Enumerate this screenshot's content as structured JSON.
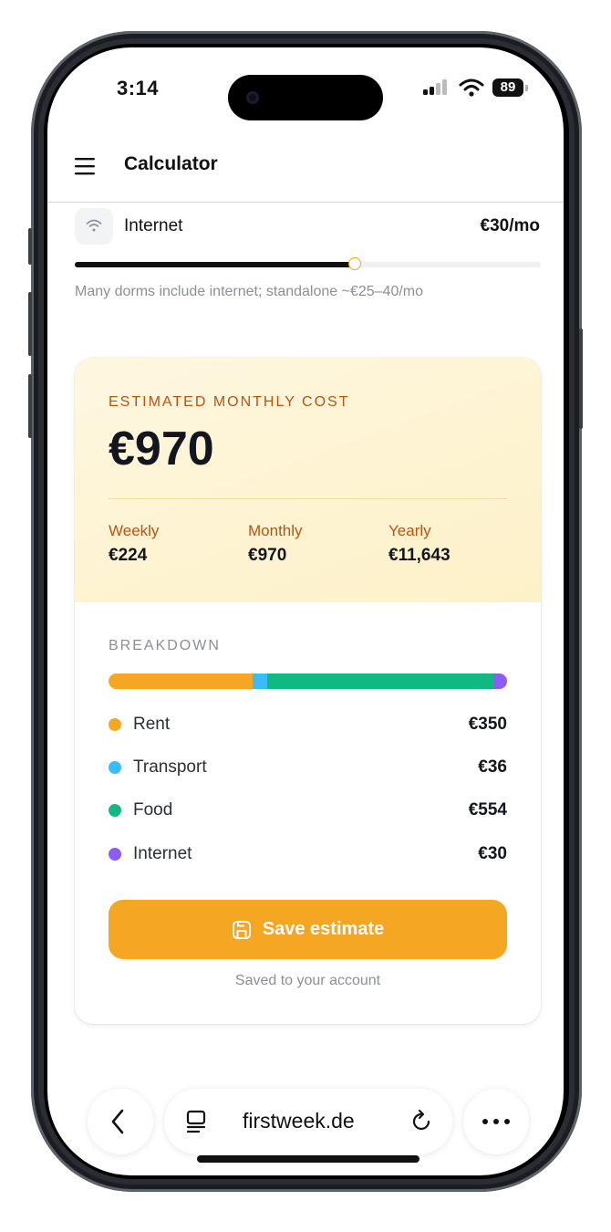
{
  "status_bar": {
    "time": "3:14",
    "battery": "89"
  },
  "header": {
    "title": "Calculator"
  },
  "internet_row": {
    "label": "Internet",
    "value": "€30/mo",
    "slider_level_percent": 60,
    "hint": "Many dorms include internet; standalone ~€25–40/mo"
  },
  "estimate": {
    "label": "ESTIMATED MONTHLY COST",
    "value": "€970",
    "periods": [
      {
        "label": "Weekly",
        "value": "€224"
      },
      {
        "label": "Monthly",
        "value": "€970"
      },
      {
        "label": "Yearly",
        "value": "€11,643"
      }
    ]
  },
  "breakdown": {
    "label": "BREAKDOWN",
    "items": [
      {
        "name": "Rent",
        "value": "€350",
        "amount": 350,
        "color": "#f5a623"
      },
      {
        "name": "Transport",
        "value": "€36",
        "amount": 36,
        "color": "#38bdf8"
      },
      {
        "name": "Food",
        "value": "€554",
        "amount": 554,
        "color": "#10b981"
      },
      {
        "name": "Internet",
        "value": "€30",
        "amount": 30,
        "color": "#8b5cf6"
      }
    ]
  },
  "save_button": {
    "label": "Save estimate",
    "icon": "save-icon"
  },
  "saved_note": "Saved to your account",
  "browser": {
    "url": "firstweek.de"
  }
}
